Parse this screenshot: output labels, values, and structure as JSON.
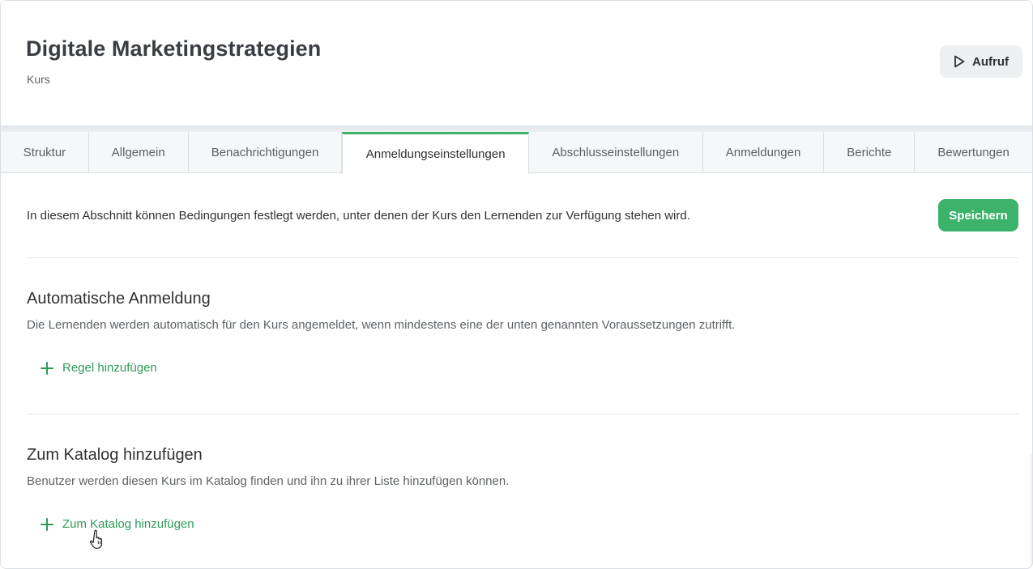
{
  "header": {
    "title": "Digitale Marketingstrategien",
    "subtitle": "Kurs",
    "run_button_label": "Aufruf",
    "run_icon": "play-icon"
  },
  "tabs": [
    {
      "label": "Struktur",
      "active": false
    },
    {
      "label": "Allgemein",
      "active": false
    },
    {
      "label": "Benachrichtigungen",
      "active": false
    },
    {
      "label": "Anmeldungseinstellungen",
      "active": true
    },
    {
      "label": "Abschlusseinstellungen",
      "active": false
    },
    {
      "label": "Anmeldungen",
      "active": false
    },
    {
      "label": "Berichte",
      "active": false
    },
    {
      "label": "Bewertungen",
      "active": false
    }
  ],
  "main": {
    "intro_text": "In diesem Abschnitt können Bedingungen festlegt werden, unter denen der Kurs den Lernenden zur Verfügung stehen wird.",
    "save_label": "Speichern",
    "sections": [
      {
        "title": "Automatische Anmeldung",
        "description": "Die Lernenden werden automatisch für den Kurs angemeldet, wenn mindestens eine der unten genannten Voraussetzungen zutrifft.",
        "action_label": "Regel hinzufügen",
        "action_icon": "plus-icon"
      },
      {
        "title": "Zum Katalog hinzufügen",
        "description": "Benutzer werden diesen Kurs im Katalog finden und ihn zu ihrer Liste hinzufügen können.",
        "action_label": "Zum Katalog hinzufügen",
        "action_icon": "plus-icon"
      }
    ]
  },
  "colors": {
    "accent": "#3cb26a",
    "link": "#2f9a58",
    "tab_bar_bg": "#f5f7f8"
  }
}
